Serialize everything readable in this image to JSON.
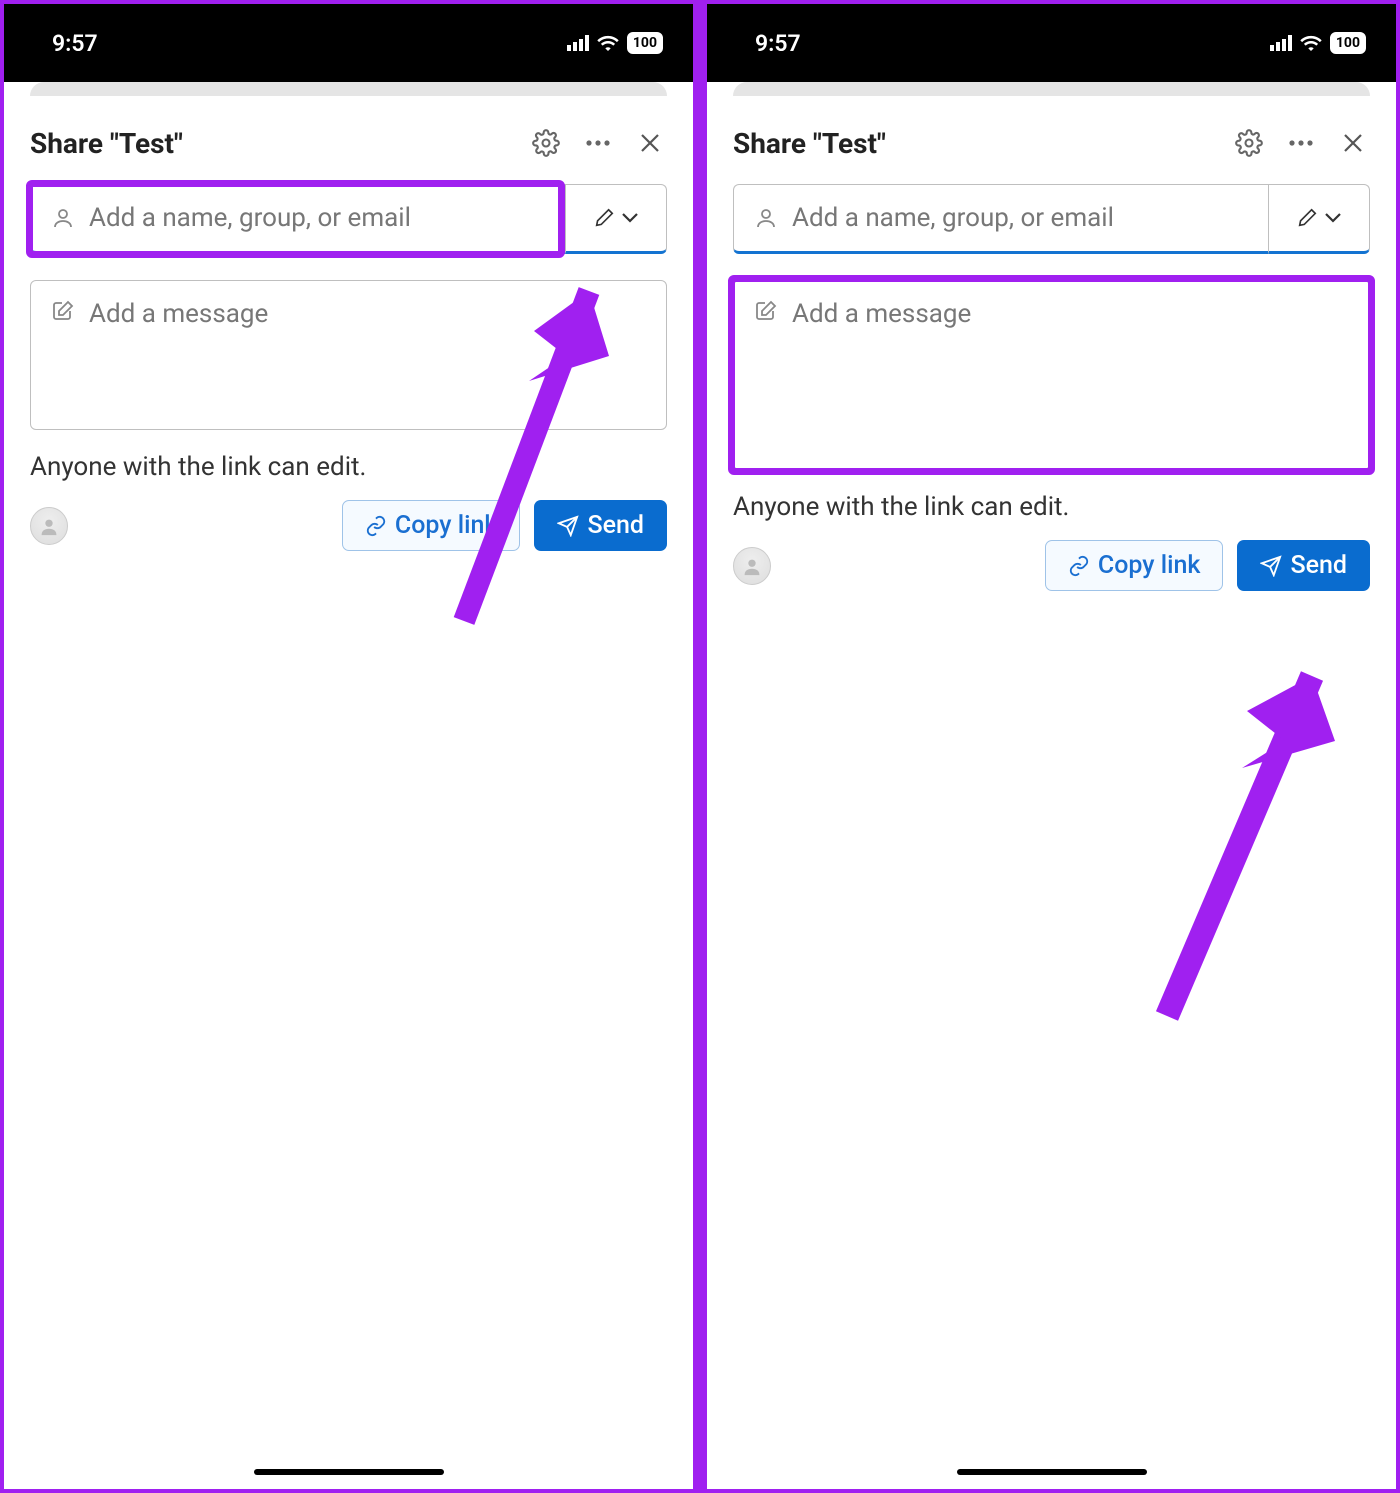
{
  "status": {
    "time": "9:57",
    "battery": "100"
  },
  "left": {
    "title": "Share \"Test\"",
    "name_placeholder": "Add a name, group, or email",
    "message_placeholder": "Add a message",
    "link_info": "Anyone with the link can edit.",
    "copy_link": "Copy link",
    "send": "Send"
  },
  "right": {
    "title": "Share \"Test\"",
    "name_placeholder": "Add a name, group, or email",
    "message_placeholder": "Add a message",
    "link_info": "Anyone with the link can edit.",
    "copy_link": "Copy link",
    "send": "Send"
  }
}
